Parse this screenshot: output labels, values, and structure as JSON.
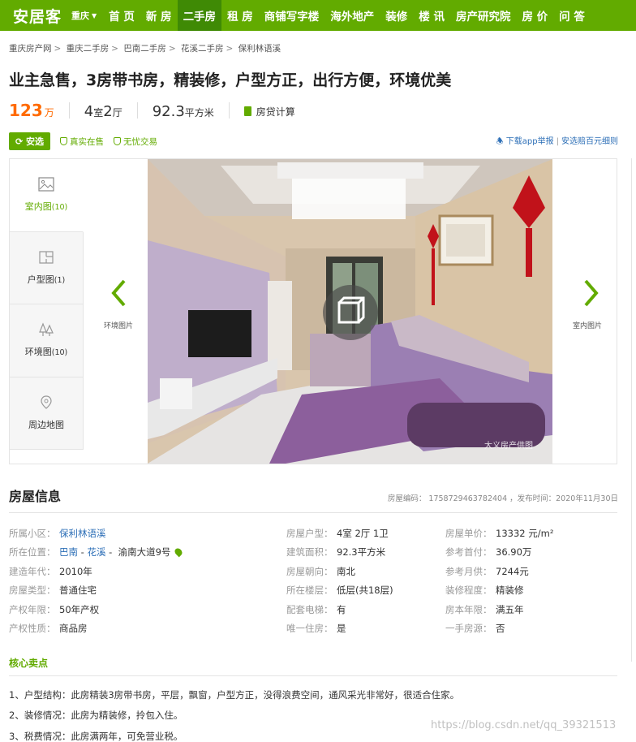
{
  "nav": {
    "logo": "安居客",
    "city": "重庆",
    "items": [
      "首 页",
      "新 房",
      "二手房",
      "租 房",
      "商铺写字楼",
      "海外地产",
      "装修",
      "楼 讯",
      "房产研究院",
      "房 价",
      "问 答"
    ],
    "active_index": 2
  },
  "breadcrumb": [
    "重庆房产网",
    "重庆二手房",
    "巴南二手房",
    "花溪二手房",
    "保利林语溪"
  ],
  "listing": {
    "title": "业主急售，3房带书房，精装修，户型方正，出行方便，环境优美",
    "price": "123",
    "price_unit": "万",
    "rooms_num1": "4",
    "rooms_unit1": "室",
    "rooms_num2": "2",
    "rooms_unit2": "厅",
    "area": "92.3",
    "area_unit": "平方米",
    "calc_label": "房贷计算"
  },
  "tags": {
    "anxuan": "安选",
    "items": [
      "真实在售",
      "无忧交易"
    ],
    "report": "下载app举报",
    "compensation": "安选赔百元细则"
  },
  "gallery": {
    "tabs": [
      {
        "label": "室内图",
        "count": "(10)",
        "icon": "image-icon"
      },
      {
        "label": "户型图",
        "count": "(1)",
        "icon": "floorplan-icon"
      },
      {
        "label": "环境图",
        "count": "(10)",
        "icon": "trees-icon"
      },
      {
        "label": "周边地图",
        "count": "",
        "icon": "map-pin-icon"
      }
    ],
    "active_tab": 0,
    "prev_label": "环境图片",
    "next_label": "室内图片",
    "watermark": "大义房产供图"
  },
  "info": {
    "heading": "房屋信息",
    "meta": "房屋编码： 1758729463782404 ，发布时间：2020年11月30日",
    "col1": [
      {
        "label": "所属小区：",
        "value": "保利林语溪",
        "link": true
      },
      {
        "label": "所在位置：",
        "value": "",
        "loc": [
          "巴南",
          "花溪",
          "渝南大道9号"
        ]
      },
      {
        "label": "建造年代：",
        "value": "2010年"
      },
      {
        "label": "房屋类型：",
        "value": "普通住宅"
      },
      {
        "label": "产权年限：",
        "value": "50年产权"
      },
      {
        "label": "产权性质：",
        "value": "商品房"
      }
    ],
    "col2": [
      {
        "label": "房屋户型：",
        "value": "4室 2厅 1卫"
      },
      {
        "label": "建筑面积：",
        "value": "92.3平方米"
      },
      {
        "label": "房屋朝向：",
        "value": "南北"
      },
      {
        "label": "所在楼层：",
        "value": "低层(共18层)"
      },
      {
        "label": "配套电梯：",
        "value": "有"
      },
      {
        "label": "唯一住房：",
        "value": "是"
      }
    ],
    "col3": [
      {
        "label": "房屋单价：",
        "value": "13332 元/m²"
      },
      {
        "label": "参考首付：",
        "value": "36.90万"
      },
      {
        "label": "参考月供：",
        "value": "7244元"
      },
      {
        "label": "装修程度：",
        "value": "精装修"
      },
      {
        "label": "房本年限：",
        "value": "满五年"
      },
      {
        "label": "一手房源：",
        "value": "否"
      }
    ]
  },
  "core": {
    "heading": "核心卖点",
    "points": [
      "1、户型结构：此房精装3房带书房，平层，飘窗，户型方正，没得浪费空间，通风采光非常好，很适合住家。",
      "2、装修情况：此房为精装修，拎包入住。",
      "3、税费情况：此房满两年，可免营业税。"
    ]
  },
  "overlay_watermark": "https://blog.csdn.net/qq_39321513",
  "colors": {
    "brand": "#62ab00",
    "price": "#ff6a00",
    "link": "#2d6fb7"
  }
}
